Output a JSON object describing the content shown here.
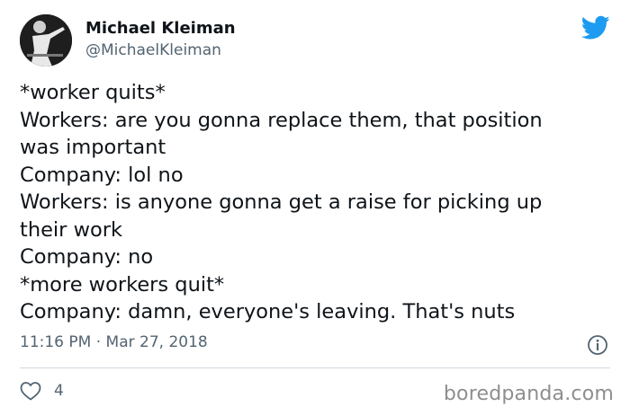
{
  "author": {
    "display_name": "Michael Kleiman",
    "handle": "@MichaelKleiman",
    "avatar_icon": "user-avatar"
  },
  "brand": {
    "logo_icon": "twitter-bird-icon",
    "logo_color": "#1d9bf0"
  },
  "tweet": {
    "lines": [
      "*worker quits*",
      "Workers: are you gonna replace them, that position",
      "was important",
      "Company: lol no",
      "Workers: is anyone gonna get a raise for picking up",
      "their work",
      "Company: no",
      "*more workers quit*",
      "Company: damn, everyone's leaving. That's nuts"
    ],
    "timestamp": "11:16 PM · Mar 27, 2018",
    "like_count": "4"
  },
  "footer": {
    "watermark": "boredpanda.com"
  },
  "colors": {
    "text_primary": "#0f1419",
    "text_secondary": "#536471",
    "divider": "#cfd9de"
  }
}
